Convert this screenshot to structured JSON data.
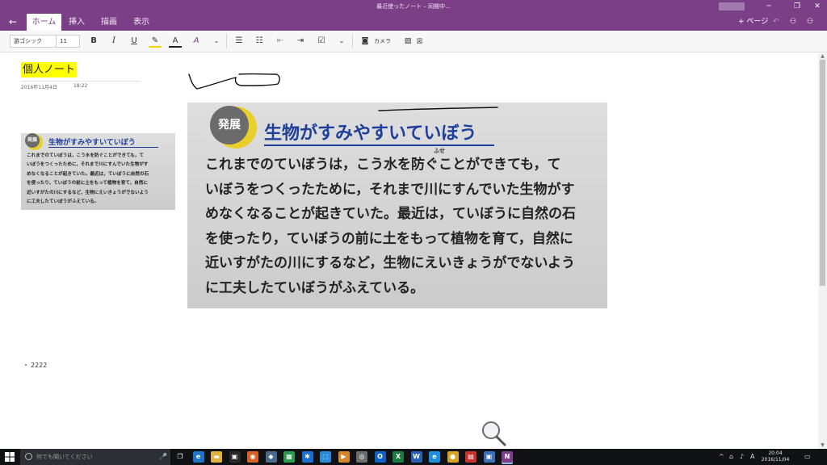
{
  "window": {
    "title": "最近使ったノート – 同期中...",
    "min_glyph": "─",
    "max_glyph": "❐",
    "close_glyph": "✕"
  },
  "nav": {
    "back_glyph": "←"
  },
  "tabs": [
    {
      "label": "ホーム"
    },
    {
      "label": "挿入"
    },
    {
      "label": "描画"
    },
    {
      "label": "表示"
    }
  ],
  "title_actions": {
    "add_page_label": "+ ページ",
    "undo_glyph": "↶",
    "share_glyph": "⚇",
    "account_glyph": "⚇"
  },
  "ribbon": {
    "font_name": "游ゴシック",
    "font_size": "11",
    "bold": "B",
    "italic": "I",
    "underline": "U",
    "highlight_glyph": "✎",
    "font_color_glyph": "A",
    "clear_format_glyph": "A",
    "more_glyph": "⌄",
    "bullets_glyph": "☰",
    "numbering_glyph": "☷",
    "outdent_glyph": "⇤",
    "indent_glyph": "⇥",
    "todo_glyph": "☑",
    "more2_glyph": "⌄",
    "camera_label": "カメラ",
    "picture_label": "図"
  },
  "page": {
    "title": "個人ノート",
    "date": "2016年11月4日",
    "time": "18:22",
    "note": "2222"
  },
  "textbook": {
    "badge": "発展",
    "heading": "生物がすみやすいていぼう",
    "ruby": "ふせ",
    "lines": [
      "これまでのていぼうは，こう水を防ぐことができても，て",
      "いぼうをつくったために，それまで川にすんでいた生物がす",
      "めなくなることが起きていた。最近は，ていぼうに自然の石",
      "を使ったり，ていぼうの前に土をもって植物を育て，自然に",
      "近いすがたの川にするなど，生物にえいきょうがでないよう",
      "に工夫したていぼうがふえている。"
    ]
  },
  "taskbar": {
    "search_placeholder": "何でも聞いてください",
    "mic_glyph": "🎤",
    "apps": [
      {
        "name": "task-view",
        "glyph": "❐",
        "color": "#101216"
      },
      {
        "name": "edge",
        "glyph": "e",
        "color": "#1e74c8"
      },
      {
        "name": "file-explorer",
        "glyph": "▬",
        "color": "#e3b23c"
      },
      {
        "name": "store",
        "glyph": "▣",
        "color": "#2a2a2a"
      },
      {
        "name": "firefox",
        "glyph": "◉",
        "color": "#d6632a"
      },
      {
        "name": "app-bird",
        "glyph": "◆",
        "color": "#4a6a8a"
      },
      {
        "name": "app-green",
        "glyph": "▦",
        "color": "#2e9a4e"
      },
      {
        "name": "app-blue",
        "glyph": "✱",
        "color": "#1b6fd0"
      },
      {
        "name": "app-sky",
        "glyph": "⬚",
        "color": "#2a8ad8"
      },
      {
        "name": "app-orange",
        "glyph": "▶",
        "color": "#d8862a"
      },
      {
        "name": "app-gray",
        "glyph": "◎",
        "color": "#6d6d6d"
      },
      {
        "name": "outlook",
        "glyph": "O",
        "color": "#0d63c4"
      },
      {
        "name": "excel",
        "glyph": "X",
        "color": "#1e7a43"
      },
      {
        "name": "word",
        "glyph": "W",
        "color": "#2a5fb5"
      },
      {
        "name": "ie",
        "glyph": "e",
        "color": "#1d8fe0"
      },
      {
        "name": "chrome",
        "glyph": "●",
        "color": "#d9a325"
      },
      {
        "name": "app-red",
        "glyph": "▤",
        "color": "#c6342b"
      },
      {
        "name": "app-monitor",
        "glyph": "▣",
        "color": "#3b6fb8"
      },
      {
        "name": "onenote",
        "glyph": "N",
        "color": "#7b3f88"
      }
    ],
    "tray": {
      "up_glyph": "^",
      "network_glyph": "⌂",
      "volume_glyph": "♪",
      "ime_glyph": "A",
      "time": "20:04",
      "date": "2016/11/04",
      "notification_glyph": "▭"
    }
  },
  "colors": {
    "accent": "#7b3f88",
    "highlight": "#ffff00",
    "heading_blue": "#1d3f9a"
  }
}
